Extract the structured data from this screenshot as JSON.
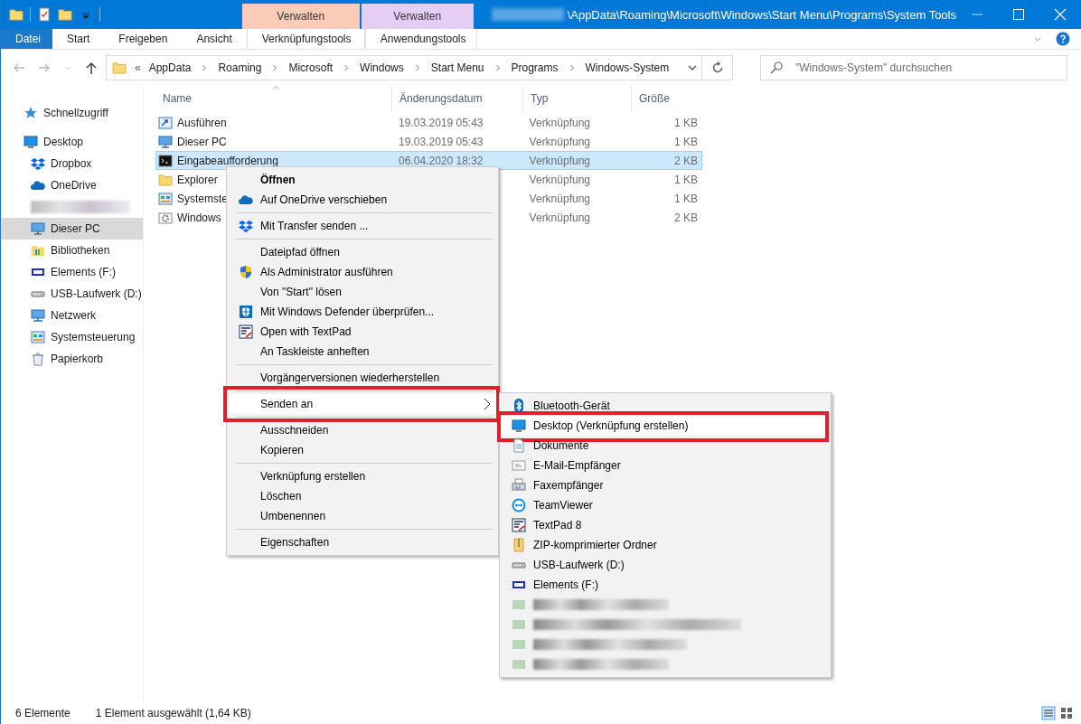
{
  "window": {
    "title": "\\AppData\\Roaming\\Microsoft\\Windows\\Start Menu\\Programs\\System Tools",
    "tool_headers": [
      {
        "label": "Verwalten",
        "color": "#f9ccb8"
      },
      {
        "label": "Verwalten",
        "color": "#e6cdf5"
      }
    ]
  },
  "ribbon_tabs": [
    {
      "label": "Datei",
      "selected": true
    },
    {
      "label": "Start",
      "selected": false
    },
    {
      "label": "Freigeben",
      "selected": false
    },
    {
      "label": "Ansicht",
      "selected": false
    },
    {
      "label": "Verknüpfungstools",
      "selected": false
    },
    {
      "label": "Anwendungstools",
      "selected": false
    }
  ],
  "address_bar": {
    "overflow": "«",
    "crumbs": [
      "AppData",
      "Roaming",
      "Microsoft",
      "Windows",
      "Start Menu",
      "Programs",
      "Windows-System"
    ]
  },
  "search": {
    "placeholder": "\"Windows-System\" durchsuchen"
  },
  "sidebar": {
    "items": [
      {
        "label": "Schnellzugriff",
        "selected": false
      },
      {
        "label": "Desktop",
        "selected": false,
        "children": [
          {
            "label": "Dropbox",
            "selected": false
          },
          {
            "label": "OneDrive",
            "selected": false
          },
          {
            "kind": "redacted"
          },
          {
            "label": "Dieser PC",
            "selected": true
          },
          {
            "label": "Bibliotheken",
            "selected": false
          },
          {
            "label": "Elements (F:)",
            "selected": false
          },
          {
            "label": "USB-Laufwerk (D:)",
            "selected": false
          },
          {
            "label": "Netzwerk",
            "selected": false
          },
          {
            "label": "Systemsteuerung",
            "selected": false
          },
          {
            "label": "Papierkorb",
            "selected": false
          }
        ]
      }
    ]
  },
  "table": {
    "columns": [
      "Name",
      "Änderungsdatum",
      "Typ",
      "Größe"
    ],
    "rows": [
      {
        "name": "Ausführen",
        "date": "19.03.2019 05:43",
        "type": "Verknüpfung",
        "size": "1 KB",
        "selected": false
      },
      {
        "name": "Dieser PC",
        "date": "19.03.2019 05:43",
        "type": "Verknüpfung",
        "size": "1 KB",
        "selected": false
      },
      {
        "name": "Eingabeaufforderung",
        "date": "06.04.2020 18:32",
        "type": "Verknüpfung",
        "size": "2 KB",
        "selected": true
      },
      {
        "name": "Explorer",
        "type": "Verknüpfung",
        "size": "1 KB",
        "selected": false
      },
      {
        "name": "Systemste",
        "type": "Verknüpfung",
        "size": "1 KB",
        "selected": false
      },
      {
        "name": "Windows",
        "type": "Verknüpfung",
        "size": "2 KB",
        "selected": false
      }
    ]
  },
  "context_menu": {
    "items": [
      {
        "label": "Öffnen",
        "default": true
      },
      {
        "label": "Auf OneDrive verschieben"
      },
      {
        "label": "Mit Transfer senden ...",
        "separator_before": true
      },
      {
        "label": "Dateipfad öffnen",
        "separator_before": true
      },
      {
        "label": "Als Administrator ausführen"
      },
      {
        "label": "Von \"Start\" lösen"
      },
      {
        "label": "Mit Windows Defender überprüfen..."
      },
      {
        "label": "Open with TextPad"
      },
      {
        "label": "An Taskleiste anheften"
      },
      {
        "label": "Vorgängerversionen wiederherstellen",
        "separator_before": true
      },
      {
        "label": "Senden an",
        "separator_before": true,
        "submenu": true,
        "highlighted": true,
        "marked": true
      },
      {
        "label": "Ausschneiden",
        "separator_before": true
      },
      {
        "label": "Kopieren"
      },
      {
        "label": "Verknüpfung erstellen",
        "separator_before": true
      },
      {
        "label": "Löschen"
      },
      {
        "label": "Umbenennen"
      },
      {
        "label": "Eigenschaften",
        "separator_before": true
      }
    ]
  },
  "send_to_menu": {
    "items": [
      {
        "label": "Bluetooth-Gerät"
      },
      {
        "label": "Desktop (Verknüpfung erstellen)",
        "highlighted": true,
        "marked": true
      },
      {
        "label": "Dokumente"
      },
      {
        "label": "E-Mail-Empfänger"
      },
      {
        "label": "Faxempfänger"
      },
      {
        "label": "TeamViewer"
      },
      {
        "label": "TextPad 8"
      },
      {
        "label": "ZIP-komprimierter Ordner"
      },
      {
        "label": "USB-Laufwerk (D:)"
      },
      {
        "label": "Elements (F:)"
      },
      {
        "kind": "redacted"
      },
      {
        "kind": "redacted"
      },
      {
        "kind": "redacted"
      },
      {
        "kind": "redacted"
      }
    ]
  },
  "status_bar": {
    "count": "6 Elemente",
    "selection": "1 Element ausgewählt (1,64 KB)"
  }
}
